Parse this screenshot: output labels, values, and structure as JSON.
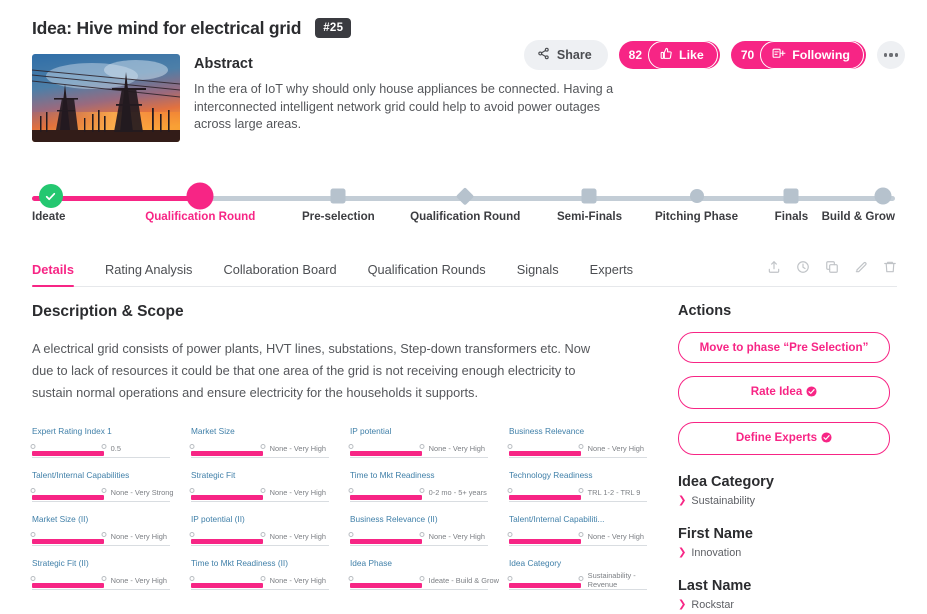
{
  "header": {
    "title": "Idea: Hive mind for electrical grid",
    "badge": "#25"
  },
  "abstract": {
    "heading": "Abstract",
    "body": "In the era of IoT why should only house appliances be connected. Having a interconnected intelligent network grid could help to avoid power outages across large areas.",
    "thumbnail_alt": "electrical-grid-pylons-sunset"
  },
  "top_actions": {
    "share_label": "Share",
    "like_count": "82",
    "like_label": "Like",
    "follow_count": "70",
    "follow_label": "Following",
    "more_label": "..."
  },
  "stepper": {
    "steps": [
      {
        "label": "Ideate",
        "state": "complete",
        "marker": "check-circle",
        "pos": 2.2
      },
      {
        "label": "Qualification Round",
        "state": "current",
        "marker": "filled-circle",
        "pos": 19.5
      },
      {
        "label": "Pre-selection",
        "state": "upcoming",
        "marker": "square",
        "pos": 35.5
      },
      {
        "label": "Qualification Round",
        "state": "upcoming",
        "marker": "diamond",
        "pos": 50.2
      },
      {
        "label": "Semi-Finals",
        "state": "upcoming",
        "marker": "square",
        "pos": 64.6
      },
      {
        "label": "Pitching Phase",
        "state": "upcoming",
        "marker": "circle",
        "pos": 77.0
      },
      {
        "label": "Finals",
        "state": "upcoming",
        "marker": "square",
        "pos": 88.0
      },
      {
        "label": "Build & Grow",
        "state": "upcoming",
        "marker": "circle-big",
        "pos": 98.6
      }
    ],
    "progress_percent": 19.5
  },
  "tabs": {
    "items": [
      {
        "label": "Details",
        "active": true
      },
      {
        "label": "Rating Analysis",
        "active": false
      },
      {
        "label": "Collaboration Board",
        "active": false
      },
      {
        "label": "Qualification Rounds",
        "active": false
      },
      {
        "label": "Signals",
        "active": false
      },
      {
        "label": "Experts",
        "active": false
      }
    ],
    "icons": [
      "upload-icon",
      "history-clock-icon",
      "copy-icon",
      "edit-icon",
      "trash-icon"
    ]
  },
  "description": {
    "heading": "Description & Scope",
    "body": "A electrical grid consists of power plants, HVT lines, substations, Step-down transformers etc. Now due to lack of resources it could be that one area of the grid is not receiving enough electricity to sustain normal operations and ensure electricity for the households it supports."
  },
  "sliders": [
    {
      "label": "Expert Rating Index 1",
      "value": "0.5",
      "fill_percent": 52
    },
    {
      "label": "Market Size",
      "value": "None - Very High",
      "fill_percent": 52
    },
    {
      "label": "IP potential",
      "value": "None - Very High",
      "fill_percent": 52
    },
    {
      "label": "Business Relevance",
      "value": "None - Very High",
      "fill_percent": 52
    },
    {
      "label": "Talent/Internal Capabilities",
      "value": "None - Very Strong",
      "fill_percent": 52
    },
    {
      "label": "Strategic Fit",
      "value": "None - Very High",
      "fill_percent": 52
    },
    {
      "label": "Time to Mkt Readiness",
      "value": "0-2 mo - 5+ years",
      "fill_percent": 52
    },
    {
      "label": "Technology Readiness",
      "value": "TRL 1-2 - TRL 9",
      "fill_percent": 52
    },
    {
      "label": "Market Size (II)",
      "value": "None - Very High",
      "fill_percent": 52
    },
    {
      "label": "IP potential (II)",
      "value": "None - Very High",
      "fill_percent": 52
    },
    {
      "label": "Business Relevance (II)",
      "value": "None - Very High",
      "fill_percent": 52
    },
    {
      "label": "Talent/Internal Capabiliti...",
      "value": "None - Very High",
      "fill_percent": 52
    },
    {
      "label": "Strategic Fit (II)",
      "value": "None - Very High",
      "fill_percent": 52
    },
    {
      "label": "Time to Mkt Readiness (II)",
      "value": "None - Very High",
      "fill_percent": 52
    },
    {
      "label": "Idea Phase",
      "value": "Ideate - Build & Grow",
      "fill_percent": 52
    },
    {
      "label": "Idea Category",
      "value": "Sustainability - Revenue",
      "fill_percent": 52,
      "two_line": true
    }
  ],
  "actions": {
    "heading": "Actions",
    "buttons": [
      {
        "label": "Move to phase “Pre Selection”",
        "check": false
      },
      {
        "label": "Rate Idea",
        "check": true
      },
      {
        "label": "Define Experts",
        "check": true
      }
    ]
  },
  "fields": [
    {
      "title": "Idea Category",
      "value": "Sustainability"
    },
    {
      "title": "First Name",
      "value": "Innovation"
    },
    {
      "title": "Last Name",
      "value": "Rockstar"
    }
  ],
  "colors": {
    "accent_pink": "#f72585",
    "complete_green": "#24c770",
    "track_gray": "#c3cdd6",
    "badge_dark": "#3a3b40"
  }
}
